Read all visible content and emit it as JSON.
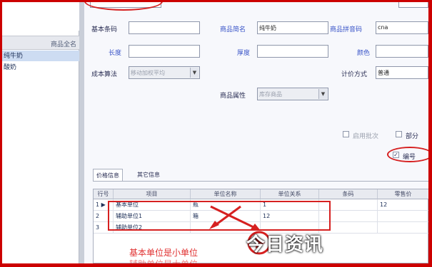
{
  "top_partial": {
    "field1_value": "",
    "field2_label": ""
  },
  "left_panel": {
    "header": "商品全名",
    "rows": [
      "纯牛奶",
      "酸奶"
    ]
  },
  "form": {
    "basic_barcode_label": "基本条码",
    "product_name_label": "商品简名",
    "product_name_value": "纯牛奶",
    "product_pinyin_label": "商品拼音码",
    "product_pinyin_value": "cna",
    "length_label": "长度",
    "thickness_label": "厚度",
    "color_label": "颜色",
    "cost_method_label": "成本算法",
    "cost_method_value": "移动加权平均",
    "pricing_label": "计价方式",
    "pricing_value": "普通",
    "attr_label": "商品属性",
    "attr_value": "库存商品",
    "checkbox1_label": "启用批次",
    "checkbox2_label": "部分",
    "checkbox3_label": "编号"
  },
  "tabs": [
    "价格信息",
    "其它信息"
  ],
  "grid": {
    "headers": [
      "行号",
      "项目",
      "单位名称",
      "单位关系",
      "条码",
      "零售价"
    ],
    "rows": [
      {
        "no": "1",
        "item": "基本单位",
        "unit": "瓶",
        "rel": "1",
        "code": "",
        "price": "12"
      },
      {
        "no": "2",
        "item": "辅助单位1",
        "unit": "箱",
        "rel": "12",
        "code": "",
        "price": ""
      },
      {
        "no": "3",
        "item": "辅助单位2",
        "unit": "",
        "rel": "",
        "code": "",
        "price": ""
      }
    ]
  },
  "annotation": {
    "line1": "基本单位是小单位",
    "line2": "辅助单位是大单位"
  },
  "watermark": "今日资讯",
  "colors": {
    "red": "#d62020",
    "accent_blue": "#3a55c8"
  }
}
